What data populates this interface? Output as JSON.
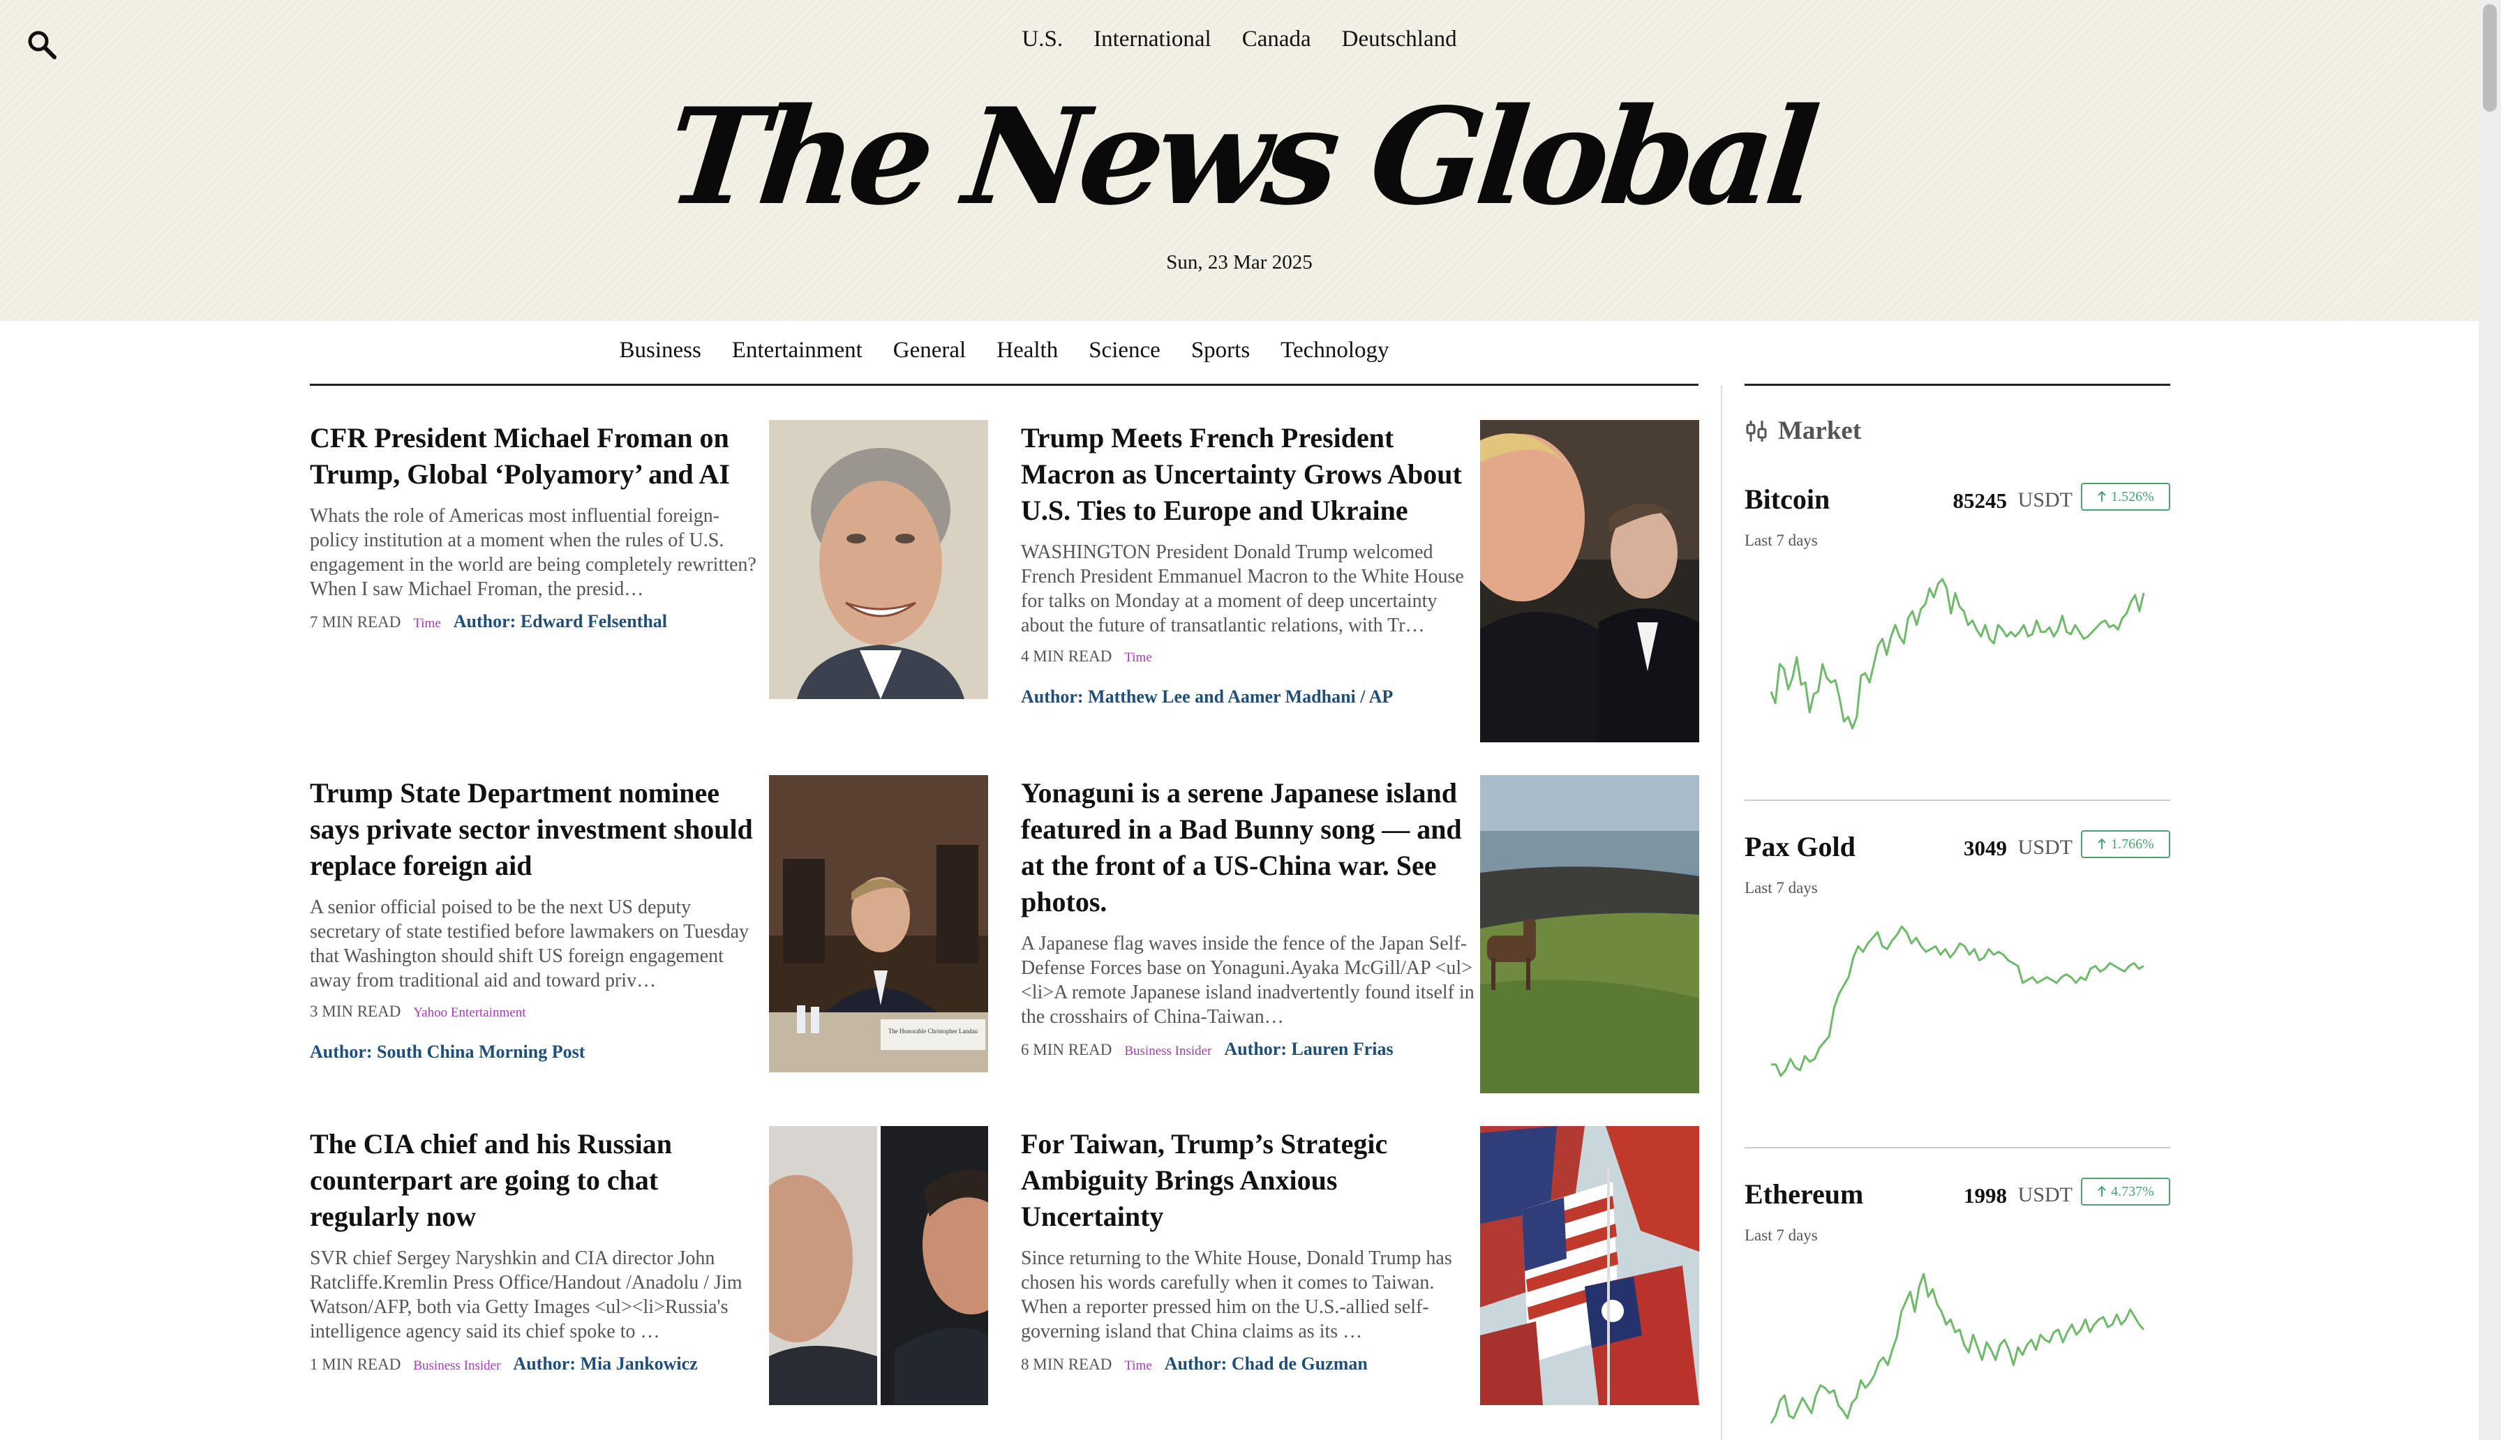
{
  "header": {
    "regions": [
      "U.S.",
      "International",
      "Canada",
      "Deutschland"
    ],
    "logo": "The News Global",
    "date": "Sun, 23 Mar 2025",
    "search_icon": "search-icon"
  },
  "nav": {
    "categories": [
      "Business",
      "Entertainment",
      "General",
      "Health",
      "Science",
      "Sports",
      "Technology"
    ]
  },
  "articles": [
    {
      "title": "CFR President Michael Froman on Trump, Global ‘Polyamory’ and AI",
      "summary": "Whats the role of Americas most influential foreign-policy institution at a moment when the rules of U.S. engagement in the world are being completely rewritten? When I saw Michael Froman, the presid…",
      "read_time": "7 MIN READ",
      "source": "Time",
      "author": "Author: Edward Felsenthal"
    },
    {
      "title": "Trump Meets French President Macron as Uncertainty Grows About U.S. Ties to Europe and Ukraine",
      "summary": "WASHINGTON President Donald Trump welcomed French President Emmanuel Macron to the White House for talks on Monday at a moment of deep uncertainty about the future of transatlantic relations, with Tr…",
      "read_time": "4 MIN READ",
      "source": "Time",
      "author": "Author: Matthew Lee and Aamer Madhani / AP"
    },
    {
      "title": "Trump State Department nominee says private sector investment should replace foreign aid",
      "summary": "A senior official poised to be the next US deputy secretary of state testified before lawmakers on Tuesday that Washington should shift US foreign engagement away from traditional aid and toward priv…",
      "read_time": "3 MIN READ",
      "source": "Yahoo Entertainment",
      "author": "Author: South China Morning Post",
      "image_caption": "The Honorable Christopher Landau"
    },
    {
      "title": "Yonaguni is a serene Japanese island featured in a Bad Bunny song — and at the front of a US-China war. See photos.",
      "summary": "A Japanese flag waves inside the fence of the Japan Self-Defense Forces base on Yonaguni.Ayaka McGill/AP <ul><li>A remote Japanese island inadvertently found itself in the crosshairs of China-Taiwan…",
      "read_time": "6 MIN READ",
      "source": "Business Insider",
      "author": "Author: Lauren Frias"
    },
    {
      "title": "The CIA chief and his Russian counterpart are going to chat regularly now",
      "summary": "SVR chief Sergey Naryshkin and CIA director John Ratcliffe.Kremlin Press Office/Handout /Anadolu / Jim Watson/AFP, both via Getty Images <ul><li>Russia's intelligence agency said its chief spoke to …",
      "read_time": "1 MIN READ",
      "source": "Business Insider",
      "author": "Author: Mia Jankowicz"
    },
    {
      "title": "For Taiwan, Trump’s Strategic Ambiguity Brings Anxious Uncertainty",
      "summary": "Since returning to the White House, Donald Trump has chosen his words carefully when it comes to Taiwan. When a reporter pressed him on the U.S.-allied self-governing island that China claims as its …",
      "read_time": "8 MIN READ",
      "source": "Time",
      "author": "Author: Chad de Guzman"
    }
  ],
  "market": {
    "title": "Market",
    "icon": "candlestick-icon",
    "coins": [
      {
        "name": "Bitcoin",
        "price": "85245",
        "unit": "USDT",
        "change": "1.526%",
        "period": "Last 7 days",
        "trend": [
          51,
          46,
          63,
          61,
          52,
          57,
          66,
          54,
          55,
          42,
          50,
          51,
          63,
          57,
          55,
          56,
          48,
          38,
          40,
          35,
          40,
          58,
          59,
          55,
          63,
          71,
          74,
          67,
          75,
          80,
          75,
          72,
          83,
          86,
          80,
          87,
          89,
          96,
          92,
          98,
          100,
          96,
          85,
          94,
          88,
          86,
          80,
          82,
          78,
          75,
          80,
          74,
          72,
          80,
          78,
          75,
          77,
          75,
          77,
          80,
          75,
          76,
          82,
          77,
          77,
          79,
          75,
          78,
          84,
          77,
          76,
          80,
          77,
          74,
          75,
          77,
          79,
          81,
          82,
          79,
          80,
          78,
          83,
          85,
          90,
          93,
          86,
          94
        ]
      },
      {
        "name": "Pax Gold",
        "price": "3049",
        "unit": "USDT",
        "change": "1.766%",
        "period": "Last 7 days",
        "trend": [
          45,
          45,
          41,
          43,
          47,
          44,
          43,
          48,
          46,
          47,
          51,
          53,
          55,
          65,
          70,
          73,
          76,
          83,
          87,
          85,
          88,
          90,
          92,
          87,
          86,
          89,
          91,
          94,
          92,
          88,
          90,
          87,
          85,
          86,
          87,
          84,
          86,
          83,
          85,
          88,
          87,
          84,
          86,
          82,
          83,
          86,
          84,
          85,
          84,
          82,
          81,
          80,
          74,
          75,
          76,
          74,
          75,
          76,
          75,
          74,
          76,
          77,
          76,
          74,
          76,
          75,
          79,
          80,
          78,
          79,
          81,
          80,
          79,
          78,
          80,
          81,
          79,
          80
        ]
      },
      {
        "name": "Ethereum",
        "price": "1998",
        "unit": "USDT",
        "change": "4.737%",
        "period": "Last 7 days",
        "trend": [
          41,
          44,
          50,
          52,
          44,
          43,
          47,
          51,
          48,
          45,
          52,
          56,
          55,
          53,
          54,
          48,
          46,
          43,
          49,
          51,
          58,
          55,
          57,
          60,
          65,
          67,
          64,
          70,
          75,
          85,
          89,
          93,
          85,
          95,
          100,
          91,
          94,
          88,
          85,
          80,
          82,
          77,
          78,
          72,
          69,
          76,
          71,
          66,
          73,
          70,
          66,
          72,
          74,
          70,
          64,
          71,
          68,
          72,
          74,
          70,
          76,
          74,
          73,
          77,
          78,
          73,
          77,
          80,
          76,
          78,
          82,
          77,
          80,
          82,
          83,
          79,
          80,
          84,
          80,
          82,
          86,
          83,
          80,
          78
        ]
      }
    ]
  }
}
